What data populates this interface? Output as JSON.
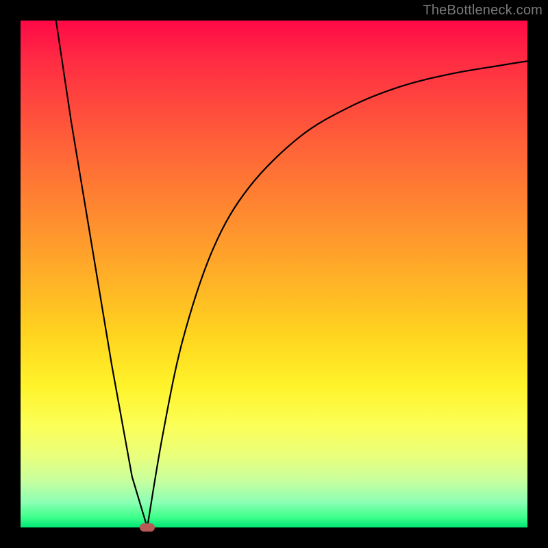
{
  "watermark": "TheBottleneck.com",
  "chart_data": {
    "type": "line",
    "title": "",
    "xlabel": "",
    "ylabel": "",
    "xlim": [
      0,
      100
    ],
    "ylim": [
      0,
      100
    ],
    "grid": false,
    "background_gradient": [
      "#ff0947",
      "#ffae28",
      "#fff32a",
      "#00e676"
    ],
    "series": [
      {
        "name": "left-branch",
        "x": [
          7,
          10,
          14,
          18,
          22,
          25
        ],
        "values": [
          100,
          80,
          56,
          32,
          10,
          0
        ]
      },
      {
        "name": "right-branch",
        "x": [
          25,
          28,
          32,
          38,
          45,
          55,
          65,
          75,
          85,
          95,
          100
        ],
        "values": [
          0,
          18,
          37,
          55,
          67,
          77,
          83,
          87,
          89.5,
          91.2,
          92
        ]
      }
    ],
    "marker": {
      "x": 25,
      "y": 0,
      "color": "#b85a56"
    }
  }
}
